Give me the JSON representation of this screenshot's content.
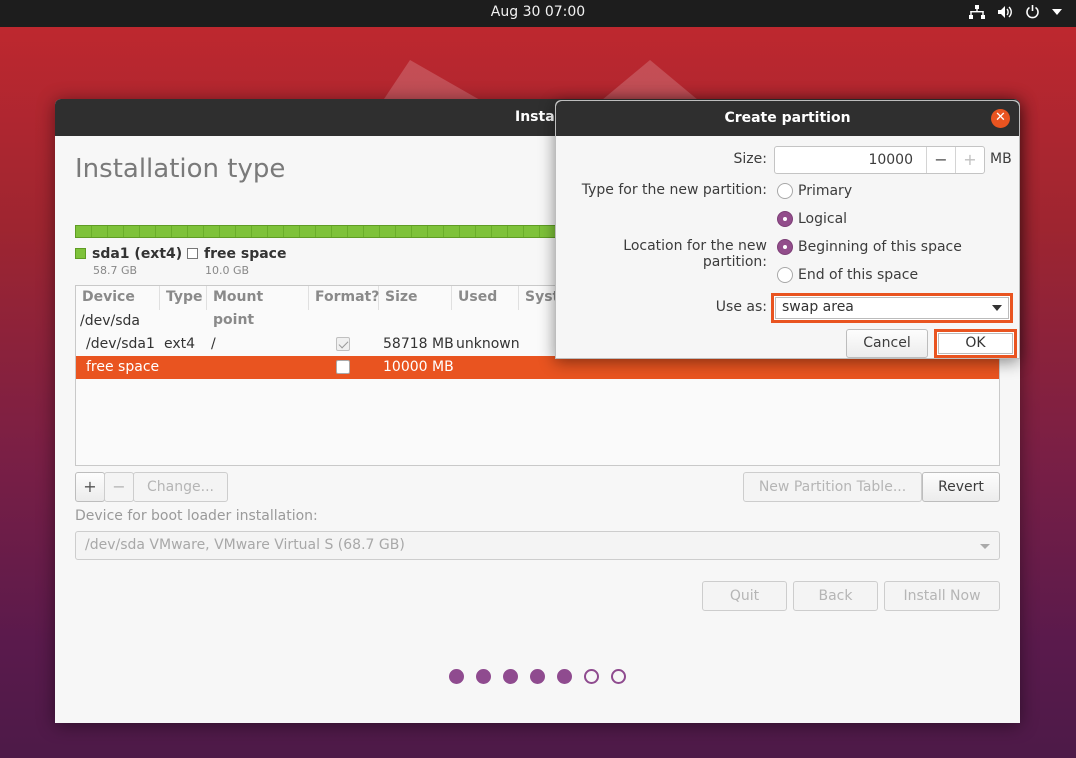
{
  "topbar": {
    "clock": "Aug 30  07:00"
  },
  "window": {
    "title": "Instal",
    "page_title": "Installation type",
    "legend": [
      {
        "label": "sda1 (ext4)",
        "size": "58.7 GB",
        "color": "#7ec23a"
      },
      {
        "label": "free space",
        "size": "10.0 GB",
        "color": "#ffffff"
      }
    ],
    "table": {
      "headers": [
        "Device",
        "Type",
        "Mount point",
        "Format?",
        "Size",
        "Used",
        "Syst"
      ],
      "rows": [
        {
          "device": "/dev/sda",
          "type": "",
          "mount": "",
          "format": null,
          "size": "",
          "used": ""
        },
        {
          "device": "/dev/sda1",
          "type": "ext4",
          "mount": "/",
          "format": true,
          "size": "58718 MB",
          "used": "unknown"
        },
        {
          "device": "free space",
          "type": "",
          "mount": "",
          "format": false,
          "size": "10000 MB",
          "used": "",
          "selected": true
        }
      ]
    },
    "buttons": {
      "add": "+",
      "remove": "−",
      "change": "Change...",
      "new_table": "New Partition Table...",
      "revert": "Revert",
      "quit": "Quit",
      "back": "Back",
      "install": "Install Now"
    },
    "boot_loader": {
      "label": "Device for boot loader installation:",
      "value": "/dev/sda   VMware, VMware Virtual S (68.7 GB)"
    },
    "progress": {
      "total": 7,
      "done": 5
    }
  },
  "dialog": {
    "title": "Create partition",
    "size_label": "Size:",
    "size_value": "10000",
    "size_unit": "MB",
    "type_label": "Type for the new partition:",
    "type_options": [
      "Primary",
      "Logical"
    ],
    "type_selected": "Logical",
    "location_label": "Location for the new partition:",
    "location_options": [
      "Beginning of this space",
      "End of this space"
    ],
    "location_selected": "Beginning of this space",
    "use_as_label": "Use as:",
    "use_as_value": "swap area",
    "cancel": "Cancel",
    "ok": "OK",
    "accent_color": "#e95420"
  }
}
